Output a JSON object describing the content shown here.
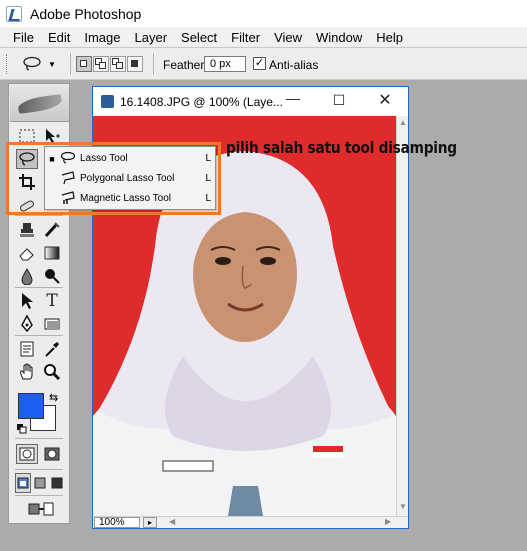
{
  "app": {
    "title": "Adobe Photoshop",
    "logo_icon": "photoshop-logo-icon"
  },
  "menu": [
    "File",
    "Edit",
    "Image",
    "Layer",
    "Select",
    "Filter",
    "View",
    "Window",
    "Help"
  ],
  "options_bar": {
    "tool_icon": "lasso-icon",
    "feather_label": "Feather:",
    "feather_value": "0 px",
    "anti_alias_label": "Anti-alias",
    "anti_alias_checked": true
  },
  "document": {
    "title": "16.1408.JPG @ 100% (Laye...",
    "zoom": "100%",
    "canvas_color": "#e02a2a"
  },
  "flyout": {
    "items": [
      {
        "label": "Lasso Tool",
        "key": "L",
        "icon": "lasso-icon",
        "active": true
      },
      {
        "label": "Polygonal Lasso Tool",
        "key": "L",
        "icon": "polygonal-lasso-icon",
        "active": false
      },
      {
        "label": "Magnetic Lasso Tool",
        "key": "L",
        "icon": "magnetic-lasso-icon",
        "active": false
      }
    ]
  },
  "annotation": {
    "text": "pilih salah satu tool disamping"
  },
  "colors": {
    "foreground": "#1e5ef0",
    "background": "#ffffff",
    "highlight": "#f07a23"
  }
}
